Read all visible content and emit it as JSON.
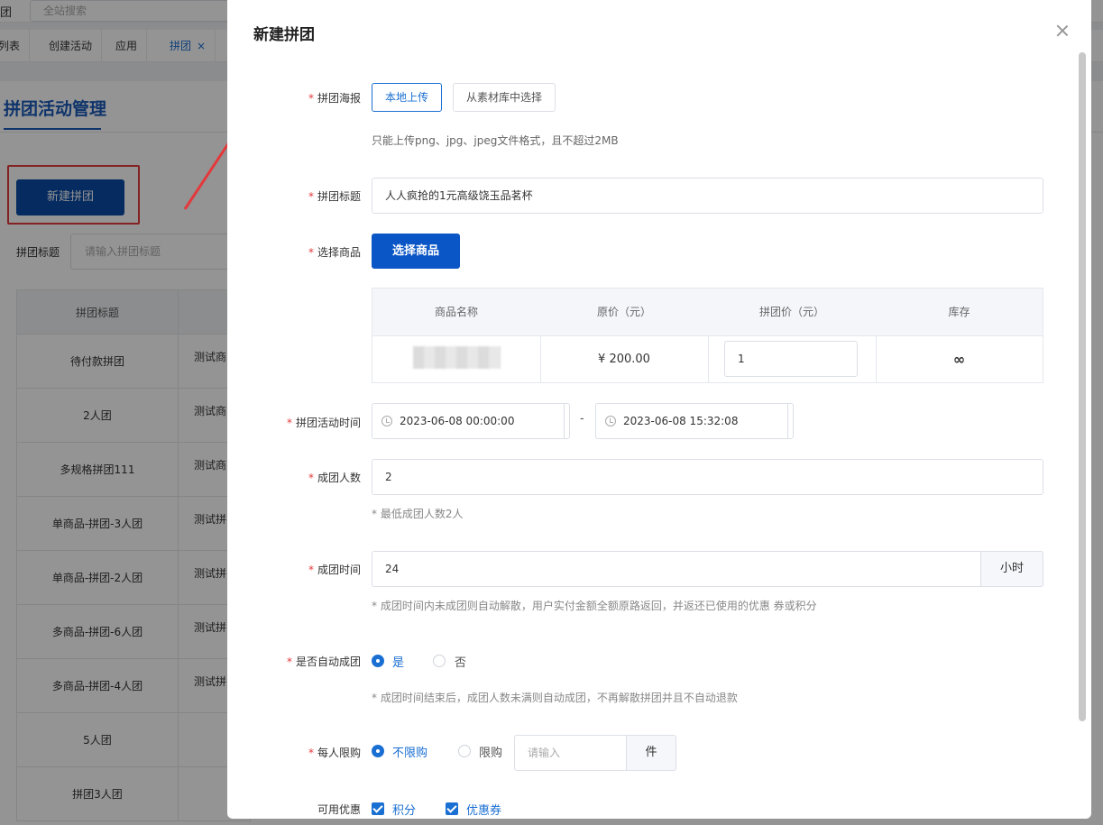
{
  "background": {
    "brand_fragment": "团",
    "search_placeholder": "全站搜索",
    "tabs": [
      {
        "label": "列表"
      },
      {
        "label": "创建活动"
      },
      {
        "label": "应用"
      },
      {
        "label": "拼团",
        "close": "×"
      }
    ],
    "page_title": "拼团活动管理",
    "new_button": "新建拼团",
    "filter_label": "拼团标题",
    "filter_placeholder": "请输入拼团标题",
    "table_header": "拼团标题",
    "rows": [
      {
        "title": "待付款拼团",
        "product": "测试商"
      },
      {
        "title": "2人团",
        "product": "测试商"
      },
      {
        "title": "多规格拼团111",
        "product": "测试商"
      },
      {
        "title": "单商品-拼团-3人团",
        "product": "测试拼"
      },
      {
        "title": "单商品-拼团-2人团",
        "product": "测试拼"
      },
      {
        "title": "多商品-拼团-6人团",
        "product": "测试拼"
      },
      {
        "title": "多商品-拼团-4人团",
        "product": "测试拼"
      },
      {
        "title": "5人团",
        "product": ""
      },
      {
        "title": "拼团3人团",
        "product": ""
      }
    ]
  },
  "modal": {
    "title": "新建拼团",
    "close_glyph": "×",
    "poster": {
      "label": "拼团海报",
      "upload_local": "本地上传",
      "from_library": "从素材库中选择",
      "hint": "只能上传png、jpg、jpeg文件格式，且不超过2MB"
    },
    "group_title": {
      "label": "拼团标题",
      "value": "人人疯抢的1元高级饶玉品茗杯"
    },
    "product": {
      "label": "选择商品",
      "button": "选择商品",
      "columns": [
        "商品名称",
        "原价（元）",
        "拼团价（元）",
        "库存"
      ],
      "row": {
        "name": "",
        "original_price": "¥ 200.00",
        "group_price": "1",
        "stock": "∞"
      }
    },
    "time": {
      "label": "拼团活动时间",
      "start": "2023-06-08 00:00:00",
      "separator": "-",
      "end": "2023-06-08 15:32:08"
    },
    "group_size": {
      "label": "成团人数",
      "value": "2",
      "hint": "* 最低成团人数2人"
    },
    "group_duration": {
      "label": "成团时间",
      "value": "24",
      "unit": "小时",
      "hint": "* 成团时间内未成团则自动解散，用户实付金额全额原路返回，并返还已使用的优惠 券或积分"
    },
    "auto_group": {
      "label": "是否自动成团",
      "yes": "是",
      "no": "否",
      "selected": "是",
      "hint": "* 成团时间结束后，成团人数未满则自动成团，不再解散拼团并且不自动退款"
    },
    "limit": {
      "label": "每人限购",
      "unlimited": "不限购",
      "limited": "限购",
      "selected": "不限购",
      "placeholder": "请输入",
      "unit": "件"
    },
    "discount": {
      "label": "可用优惠",
      "points": "积分",
      "coupon": "优惠券"
    }
  },
  "colors": {
    "primary": "#0a56c6",
    "accent": "#1a6fd2",
    "required": "#e4393c",
    "annotation": "#e4393c"
  }
}
